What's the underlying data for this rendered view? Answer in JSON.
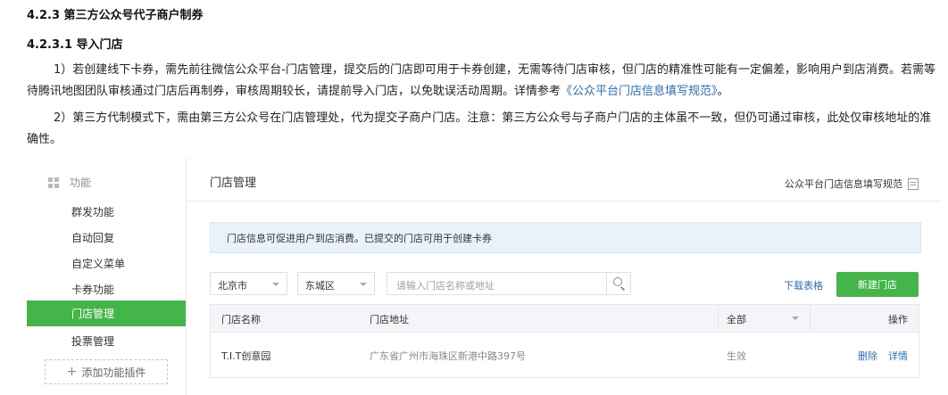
{
  "doc": {
    "heading_423": "4.2.3 第三方公众号代子商户制券",
    "heading_4231": "4.2.3.1 导入门店",
    "para1_prefix": "1）若创建线下卡券，需先前往微信公众平台-门店管理，提交后的门店即可用于卡券创建，无需等待门店审核，但门店的精准性可能有一定偏差，影响用户到店消费。若需等待腾讯地图团队审核通过门店后再制券，审核周期较长，请提前导入门店，以免耽误活动周期。详情参考",
    "para1_link": "《公众平台门店信息填写规范》",
    "para1_suffix": "。",
    "para2": "2）第三方代制模式下，需由第三方公众号在门店管理处，代为提交子商户门店。注意：第三方公众号与子商户门店的主体虽不一致，但仍可通过审核，此处仅审核地址的准确性。"
  },
  "sidebar": {
    "section_label": "功能",
    "items": [
      "群发功能",
      "自动回复",
      "自定义菜单",
      "卡券功能",
      "门店管理",
      "投票管理"
    ],
    "active_item": "门店管理",
    "add_plugin_label": "添加功能插件"
  },
  "main": {
    "title": "门店管理",
    "spec_link": "公众平台门店信息填写规范",
    "notice": "门店信息可促进用户到店消费。已提交的门店可用于创建卡券",
    "city_select": "北京市",
    "district_select": "东城区",
    "search_placeholder": "请输入门店名称或地址",
    "download_link": "下载表格",
    "new_button": "新建门店",
    "table": {
      "col_name": "门店名称",
      "col_address": "门店地址",
      "col_status_filter": "全部",
      "col_actions": "操作",
      "rows": [
        {
          "name": "T.I.T创意园",
          "address": "广东省广州市海珠区新港中路397号",
          "status": "生效",
          "delete": "删除",
          "detail": "详情"
        }
      ]
    }
  },
  "colors": {
    "accent_green": "#44b549",
    "link_blue": "#2b6fb6",
    "notice_bg": "#e9f1fb"
  }
}
